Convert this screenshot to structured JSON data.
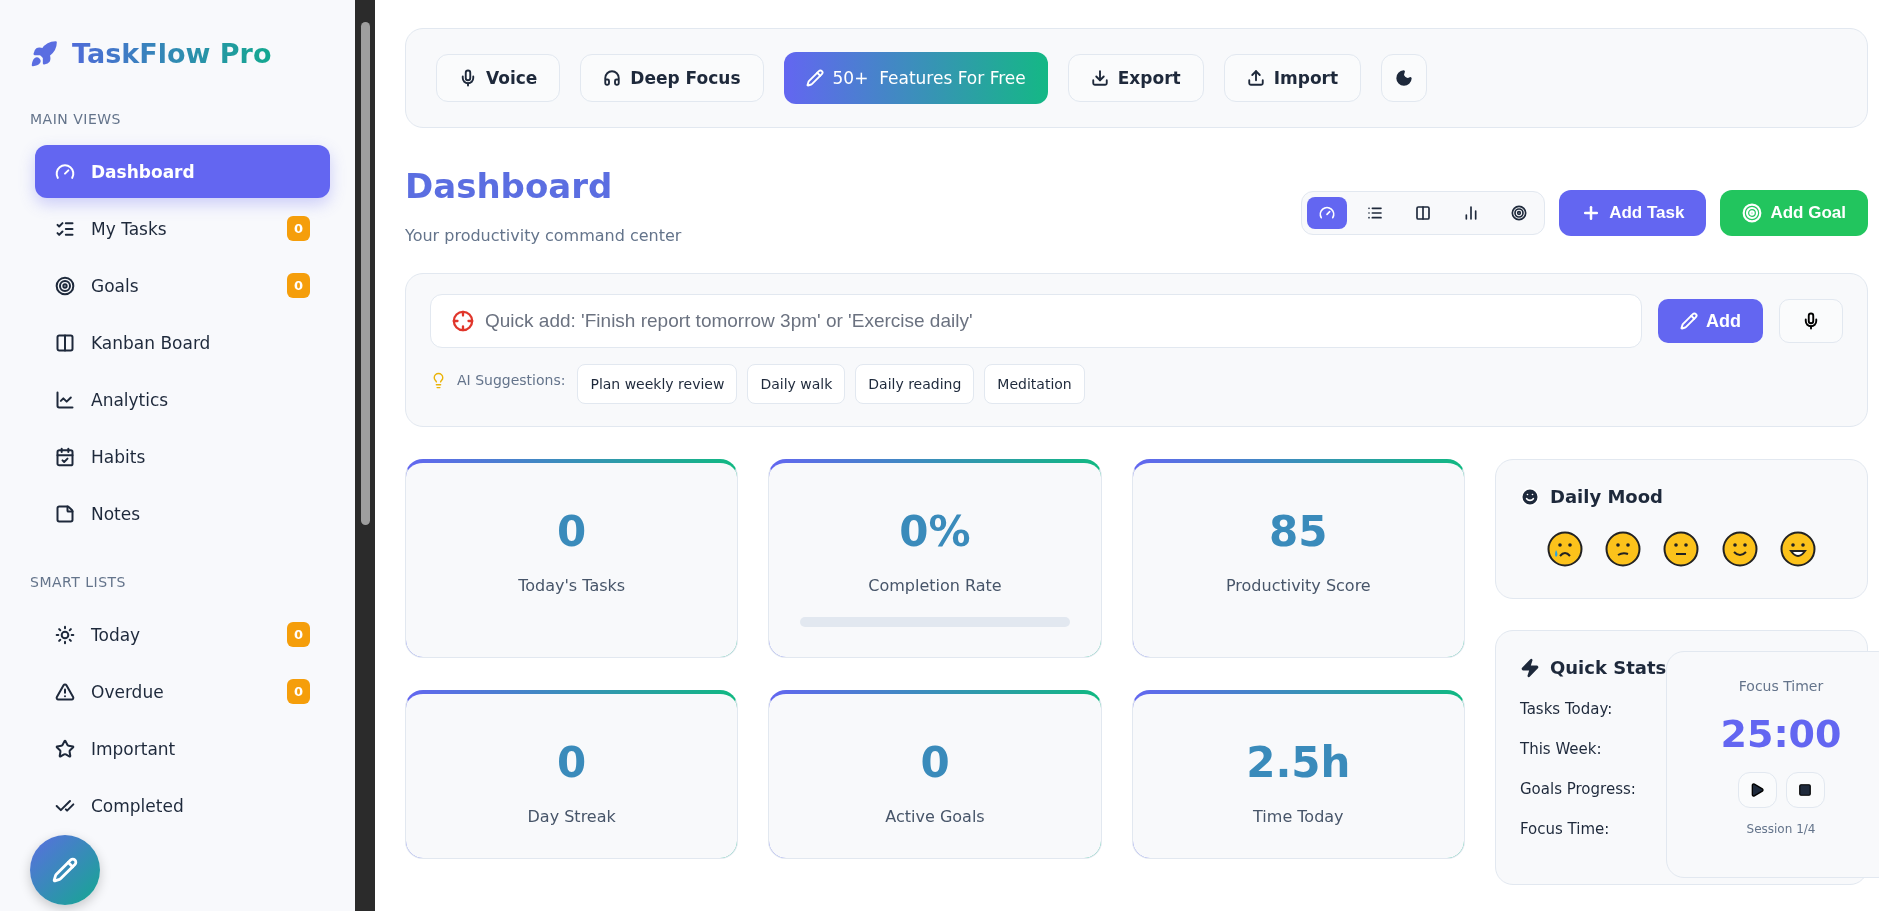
{
  "sidebar": {
    "logo": "TaskFlow Pro",
    "sections": [
      {
        "title": "MAIN VIEWS",
        "items": [
          {
            "label": "Dashboard",
            "selected": true
          },
          {
            "label": "My Tasks",
            "selected": false,
            "badge": "0"
          },
          {
            "label": "Goals",
            "selected": false,
            "badge": "0"
          },
          {
            "label": "Kanban Board",
            "selected": false
          },
          {
            "label": "Analytics",
            "selected": false
          },
          {
            "label": "Habits",
            "selected": false
          },
          {
            "label": "Notes",
            "selected": false
          }
        ]
      },
      {
        "title": "SMART LISTS",
        "items": [
          {
            "label": "Today",
            "selected": false,
            "badge": "0"
          },
          {
            "label": "Overdue",
            "selected": false,
            "badge": "0"
          },
          {
            "label": "Important",
            "selected": false
          },
          {
            "label": "Completed",
            "selected": false
          }
        ]
      }
    ]
  },
  "toolbar": [
    {
      "label": "Voice",
      "kind": "plain"
    },
    {
      "label": "Deep Focus",
      "kind": "plain"
    },
    {
      "label": "50+  Features For Free",
      "kind": "promo"
    },
    {
      "label": "Export",
      "kind": "plain"
    },
    {
      "label": "Import",
      "kind": "plain"
    },
    {
      "kind": "icon"
    }
  ],
  "header": {
    "title": "Dashboard",
    "subtitle": "Your productivity command center",
    "views": [
      {
        "selected": true
      },
      {
        "selected": false
      },
      {
        "selected": false
      },
      {
        "selected": false
      },
      {
        "selected": false
      }
    ],
    "add_task": "Add Task",
    "add_goal": "Add Goal"
  },
  "quick_add": {
    "placeholder": "Quick add: 'Finish report tomorrow 3pm' or 'Exercise daily'",
    "add": "Add",
    "suggestions_label": "AI Suggestions:",
    "suggestions": [
      "Plan weekly review",
      "Daily walk",
      "Daily reading",
      "Meditation"
    ]
  },
  "stats": [
    {
      "value": "0",
      "label": "Today's Tasks"
    },
    {
      "value": "0%",
      "label": "Completion Rate",
      "level": 0
    },
    {
      "value": "85",
      "label": "Productivity Score"
    },
    {
      "value": "0",
      "label": "Day Streak"
    },
    {
      "value": "0",
      "label": "Active Goals"
    },
    {
      "value": "2.5h",
      "label": "Time Today"
    }
  ],
  "mood": {
    "title": "Daily Mood",
    "options": [
      {
        "kind": "crying",
        "selected": false
      },
      {
        "kind": "confused",
        "selected": false
      },
      {
        "kind": "neutral",
        "selected": false
      },
      {
        "kind": "smiling",
        "selected": false
      },
      {
        "kind": "grinning",
        "selected": false
      }
    ]
  },
  "quick_stats": {
    "title": "Quick Stats",
    "rows": [
      "Tasks Today:",
      "This Week:",
      "Goals Progress:",
      "Focus Time:"
    ]
  },
  "focus_timer": {
    "title": "Focus Timer",
    "time": "25:00",
    "session": "Session 1/4"
  }
}
